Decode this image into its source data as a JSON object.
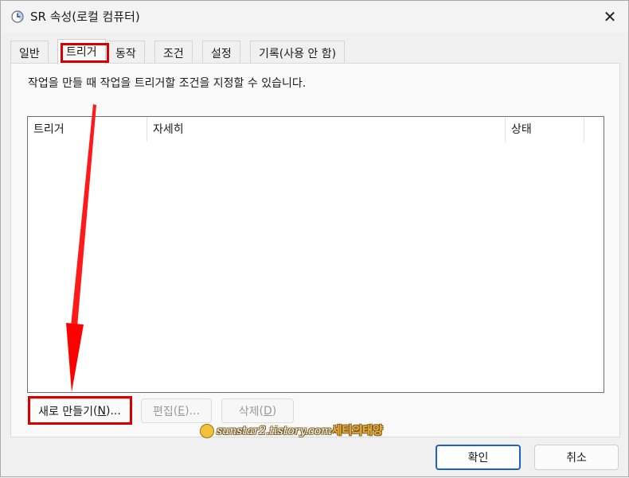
{
  "window": {
    "title": "SR 속성(로컬 컴퓨터)",
    "close_glyph": "✕"
  },
  "tabs": [
    {
      "label": "일반"
    },
    {
      "label": "트리거"
    },
    {
      "label": "동작"
    },
    {
      "label": "조건"
    },
    {
      "label": "설정"
    },
    {
      "label": "기록(사용 안 함)"
    }
  ],
  "active_tab": "트리거",
  "panel": {
    "description": "작업을 만들 때 작업을 트리거할 조건을 지정할 수 있습니다."
  },
  "list": {
    "columns": [
      "트리거",
      "자세히",
      "상태"
    ],
    "rows": []
  },
  "buttons": {
    "new_label": "새로 만들기",
    "new_key": "N",
    "new_suffix": "...",
    "edit_label": "편집",
    "edit_key": "E",
    "edit_suffix": "...",
    "delete_label": "삭제",
    "delete_key": "D",
    "ok_label": "확인",
    "cancel_label": "취소"
  },
  "watermark": {
    "site": "sunstar2.tistory.com",
    "brand": "세티의태양"
  },
  "colors": {
    "highlight": "#d60000",
    "focus_border": "#1a62c7"
  }
}
